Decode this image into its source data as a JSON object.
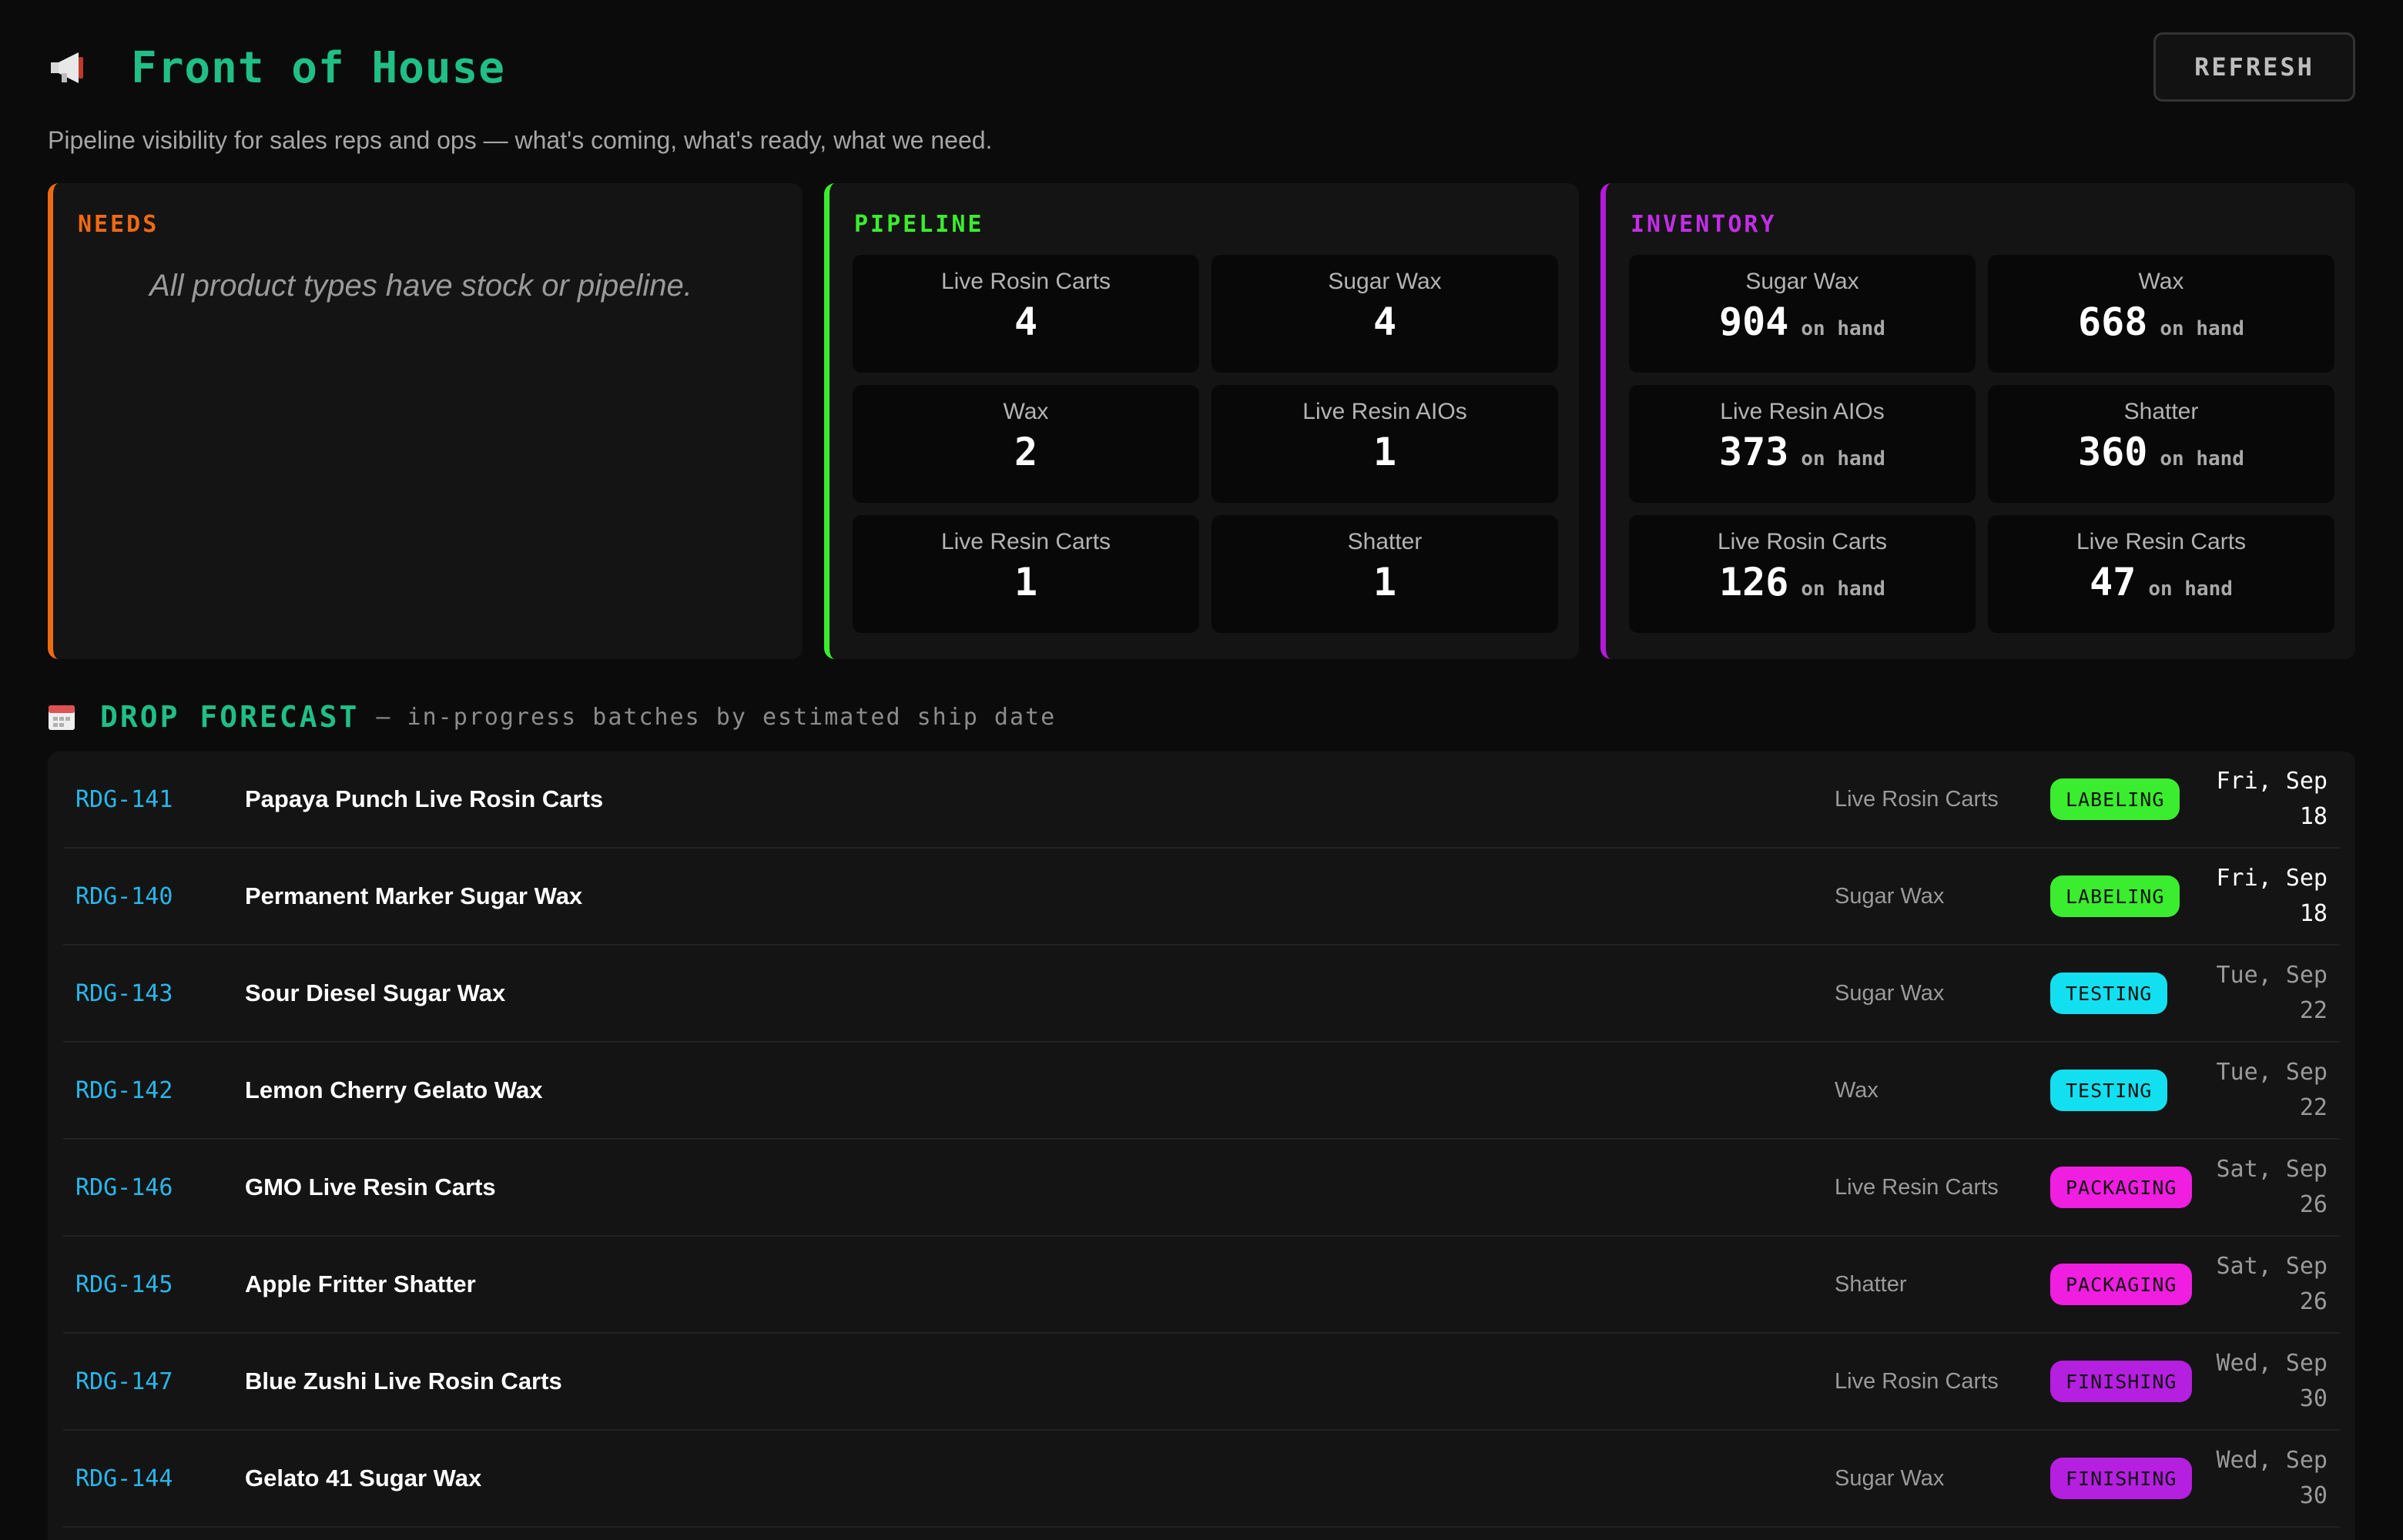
{
  "header": {
    "icon": "megaphone-icon",
    "title": "Front of House",
    "refresh_label": "REFRESH",
    "subtitle": "Pipeline visibility for sales reps and ops — what's coming, what's ready, what we need."
  },
  "needs": {
    "title": "NEEDS",
    "message": "All product types have stock or pipeline.",
    "accent": "#f06a12"
  },
  "pipeline": {
    "title": "PIPELINE",
    "accent": "#3aed2e",
    "tiles": [
      {
        "label": "Live Rosin Carts",
        "value": "4"
      },
      {
        "label": "Sugar Wax",
        "value": "4"
      },
      {
        "label": "Wax",
        "value": "2"
      },
      {
        "label": "Live Resin AIOs",
        "value": "1"
      },
      {
        "label": "Live Resin Carts",
        "value": "1"
      },
      {
        "label": "Shatter",
        "value": "1"
      }
    ]
  },
  "inventory": {
    "title": "INVENTORY",
    "accent": "#c22ee6",
    "tiles": [
      {
        "label": "Sugar Wax",
        "value": "904",
        "unit": "on hand"
      },
      {
        "label": "Wax",
        "value": "668",
        "unit": "on hand"
      },
      {
        "label": "Live Resin AIOs",
        "value": "373",
        "unit": "on hand"
      },
      {
        "label": "Shatter",
        "value": "360",
        "unit": "on hand"
      },
      {
        "label": "Live Rosin Carts",
        "value": "126",
        "unit": "on hand"
      },
      {
        "label": "Live Resin Carts",
        "value": "47",
        "unit": "on hand"
      }
    ]
  },
  "forecast": {
    "icon": "calendar-icon",
    "title": "DROP FORECAST",
    "subtitle": "— in-progress batches by estimated ship date",
    "status_colors": {
      "LABELING": "#3aed2e",
      "TESTING": "#12e0f0",
      "PACKAGING": "#f01ee0",
      "FINISHING": "#b51fe0"
    },
    "rows": [
      {
        "id": "RDG-141",
        "name": "Papaya Punch Live Rosin Carts",
        "type": "Live Rosin Carts",
        "status": "LABELING",
        "date_line1": "Fri, Sep",
        "date_line2": "18"
      },
      {
        "id": "RDG-140",
        "name": "Permanent Marker Sugar Wax",
        "type": "Sugar Wax",
        "status": "LABELING",
        "date_line1": "Fri, Sep",
        "date_line2": "18"
      },
      {
        "id": "RDG-143",
        "name": "Sour Diesel Sugar Wax",
        "type": "Sugar Wax",
        "status": "TESTING",
        "date_line1": "Tue, Sep",
        "date_line2": "22"
      },
      {
        "id": "RDG-142",
        "name": "Lemon Cherry Gelato Wax",
        "type": "Wax",
        "status": "TESTING",
        "date_line1": "Tue, Sep",
        "date_line2": "22"
      },
      {
        "id": "RDG-146",
        "name": "GMO Live Resin Carts",
        "type": "Live Resin Carts",
        "status": "PACKAGING",
        "date_line1": "Sat, Sep",
        "date_line2": "26"
      },
      {
        "id": "RDG-145",
        "name": "Apple Fritter Shatter",
        "type": "Shatter",
        "status": "PACKAGING",
        "date_line1": "Sat, Sep",
        "date_line2": "26"
      },
      {
        "id": "RDG-147",
        "name": "Blue Zushi Live Rosin Carts",
        "type": "Live Rosin Carts",
        "status": "FINISHING",
        "date_line1": "Wed, Sep",
        "date_line2": "30"
      },
      {
        "id": "RDG-144",
        "name": "Gelato 41 Sugar Wax",
        "type": "Sugar Wax",
        "status": "FINISHING",
        "date_line1": "Wed, Sep",
        "date_line2": "30"
      }
    ]
  }
}
